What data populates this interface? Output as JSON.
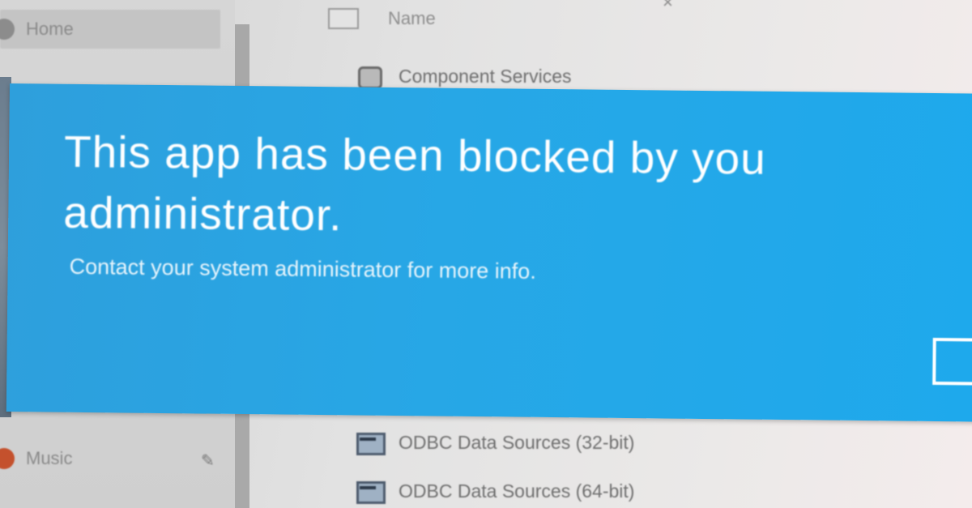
{
  "background": {
    "nav": {
      "items": [
        {
          "label": "Home",
          "icon": "home-icon"
        },
        {
          "label": "Music",
          "icon": "music-icon"
        }
      ],
      "pin_icon": "pin-icon"
    },
    "file_list": {
      "column_header": "Name",
      "rows": [
        {
          "label": "Component Services",
          "icon": "component-services-icon"
        },
        {
          "label": "ODBC Data Sources (32-bit)",
          "icon": "odbc-icon"
        },
        {
          "label": "ODBC Data Sources (64-bit)",
          "icon": "odbc-icon"
        }
      ]
    }
  },
  "banner": {
    "title_line1": "This app has been blocked by you",
    "title_line2": "administrator.",
    "subtitle": "Contact your system administrator for more info.",
    "button_label": "",
    "color": "#27a7e6"
  }
}
